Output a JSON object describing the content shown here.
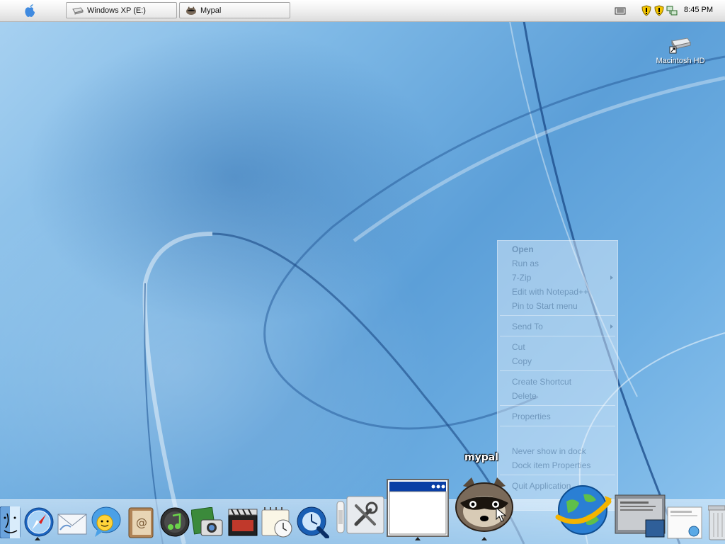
{
  "menubar": {
    "apple_icon": "apple-icon",
    "tasks": [
      {
        "label": "Windows XP (E:)",
        "icon": "drive-icon"
      },
      {
        "label": "Mypal",
        "icon": "mypal-raccoon-icon"
      }
    ],
    "tray_icons": [
      "keyboard-icon",
      "security-shield-icon",
      "security-shield-icon",
      "network-icon"
    ],
    "clock": "8:45 PM"
  },
  "desktop": {
    "icons": [
      {
        "label": "Macintosh HD",
        "icon": "hard-drive-icon"
      }
    ]
  },
  "context_menu": {
    "items": {
      "open": "Open",
      "run_as": "Run as",
      "zip": "7-Zip",
      "edit_notepad": "Edit with Notepad++",
      "pin_start": "Pin to Start menu",
      "send_to": "Send To",
      "cut": "Cut",
      "copy": "Copy",
      "create_shortcut": "Create Shortcut",
      "delete": "Delete",
      "properties": "Properties",
      "never_show": "Never show in dock",
      "dock_props": "Dock item Properties",
      "quit": "Quit Application"
    }
  },
  "dock": {
    "hover_label": "mypal",
    "items": [
      "finder-icon",
      "safari-icon",
      "mail-icon",
      "ichat-icon",
      "address-book-icon",
      "itunes-icon",
      "iphoto-icon",
      "imovie-icon",
      "ical-icon",
      "quicktime-icon",
      "dock-separator-icon",
      "utilities-icon",
      "window-app-icon",
      "mypal-raccoon-icon",
      "internet-globe-icon",
      "screenshot-icon",
      "preview-icon",
      "trash-icon"
    ]
  },
  "colors": {
    "accent": "#0a3fa5",
    "wallpaper": "#6daee2"
  }
}
